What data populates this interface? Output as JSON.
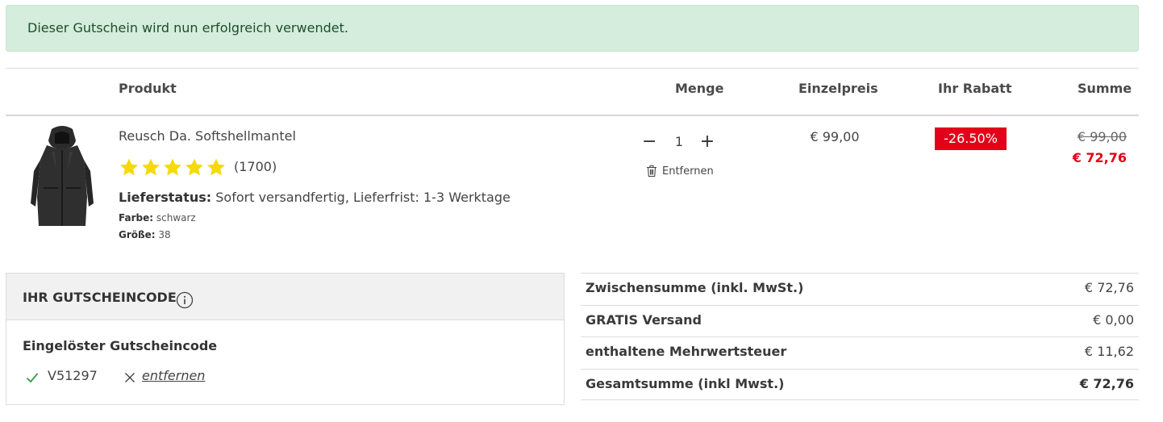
{
  "alert": {
    "message": "Dieser Gutschein wird nun erfolgreich verwendet."
  },
  "table_header": {
    "product": "Produkt",
    "quantity": "Menge",
    "unit_price": "Einzelpreis",
    "discount": "Ihr Rabatt",
    "sum": "Summe"
  },
  "item": {
    "name": "Reusch Da. Softshellmantel",
    "rating_stars": 5,
    "review_count": "(1700)",
    "delivery_label": "Lieferstatus:",
    "delivery_text": " Sofort versandfertig, Lieferfrist: 1-3 Werktage",
    "color_label": "Farbe:",
    "color_value": " schwarz",
    "size_label": "Größe:",
    "size_value": " 38",
    "quantity": "1",
    "minus_label": "−",
    "plus_label": "+",
    "remove_label": "Entfernen",
    "unit_price": "€ 99,00",
    "discount_badge": "-26.50%",
    "old_price": "€ 99,00",
    "new_price": "€ 72,76"
  },
  "coupon": {
    "title": "IHR GUTSCHEINCODE",
    "redeemed_label": "Eingelöster Gutscheincode",
    "code": "V51297",
    "remove_label": "entfernen"
  },
  "totals": {
    "subtotal_label": "Zwischensumme (inkl. MwSt.)",
    "subtotal_value": "€ 72,76",
    "shipping_label": "GRATIS Versand",
    "shipping_value": "€ 0,00",
    "tax_label": "enthaltene Mehrwertsteuer",
    "tax_value": "€ 11,62",
    "total_label": "Gesamtsumme (inkl Mwst.)",
    "total_value": "€ 72,76"
  },
  "colors": {
    "alert_bg": "#d4eddc",
    "accent_red": "#e2001a",
    "star_yellow": "#f5d90a",
    "check_green": "#3c9a4a"
  },
  "icons": [
    "info-icon",
    "trash-icon",
    "check-icon",
    "close-icon",
    "star-icon"
  ]
}
